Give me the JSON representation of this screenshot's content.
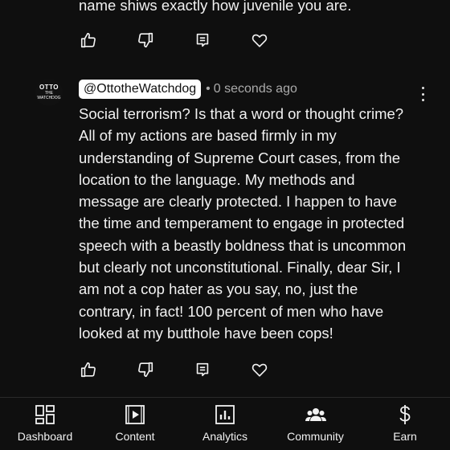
{
  "previous_comment": {
    "text_tail": "name shiws exactly how juvenile you are."
  },
  "comment": {
    "avatar_text": [
      "OTTO",
      "THE",
      "WATCHDOG"
    ],
    "handle": "@OttotheWatchdog",
    "separator": "•",
    "timestamp": "0 seconds ago",
    "lines": [
      "Social terrorism?  Is that a word or thought crime?",
      "All of my actions are based firmly in my",
      "understanding of Supreme Court cases, from the",
      "location to the language. My methods and",
      "message are clearly protected.  I happen to have",
      "the time and temperament to engage in protected",
      "speech with a beastly boldness that is uncommon",
      "but clearly not unconstitutional.  Finally, dear Sir, I",
      "am not a cop hater as you say, no, just the",
      "contrary, in fact! 100 percent of men who have",
      "looked at my butthole have been cops!"
    ]
  },
  "actions": {
    "icons": [
      "thumbs-up-icon",
      "thumbs-down-icon",
      "reply-icon",
      "heart-icon"
    ]
  },
  "bottom_nav": {
    "items": [
      {
        "label": "Dashboard",
        "icon": "dashboard-icon"
      },
      {
        "label": "Content",
        "icon": "content-icon"
      },
      {
        "label": "Analytics",
        "icon": "analytics-icon"
      },
      {
        "label": "Community",
        "icon": "community-icon"
      },
      {
        "label": "Earn",
        "icon": "earn-icon"
      }
    ]
  },
  "colors": {
    "background": "#0f0f0f",
    "text": "#f1f1f1",
    "secondary_text": "#aaaaaa",
    "handle_bg": "#ffffff"
  }
}
